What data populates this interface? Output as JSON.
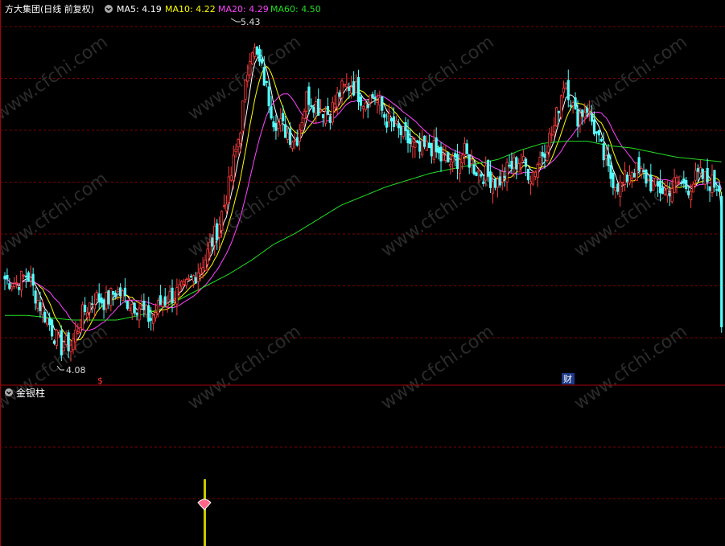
{
  "header": {
    "stock_label": "方大集团(日线 前复权)",
    "ma_labels": [
      {
        "text": "MA5: 4.19",
        "color": "#ffffff"
      },
      {
        "text": "MA10: 4.22",
        "color": "#ffff00"
      },
      {
        "text": "MA20: 4.29",
        "color": "#ff44ff"
      },
      {
        "text": "MA60: 4.50",
        "color": "#22dd22"
      }
    ]
  },
  "lower_pane": {
    "title": "金银柱"
  },
  "markers": {
    "s_marker": "$",
    "cai_marker": "财"
  },
  "watermark": "www.cfchi.com",
  "colors": {
    "up": "#ff3c3c",
    "down": "#54ffff",
    "grid": "#7a0000",
    "border": "#aa0000",
    "ma5": "#ffffff",
    "ma10": "#ffff00",
    "ma20": "#ff44ff",
    "ma60": "#22dd22",
    "signal_bar": "#c8c800",
    "signal_icon": "#ff6688"
  },
  "chart_data": {
    "type": "candlestick",
    "high_label": "5.43",
    "low_label": "4.08",
    "high_value": 5.43,
    "low_value": 4.08,
    "ylim": [
      4.02,
      5.5
    ],
    "close_path": [
      4.4,
      4.38,
      4.42,
      4.3,
      4.2,
      4.1,
      4.12,
      4.25,
      4.32,
      4.3,
      4.35,
      4.3,
      4.28,
      4.22,
      4.3,
      4.33,
      4.35,
      4.42,
      4.5,
      4.62,
      4.8,
      5.05,
      5.43,
      5.3,
      5.1,
      5.05,
      5.0,
      5.2,
      5.15,
      5.12,
      5.22,
      5.25,
      5.18,
      5.2,
      5.1,
      5.05,
      5.0,
      4.95,
      4.98,
      4.92,
      4.9,
      4.95,
      4.88,
      4.85,
      4.82,
      4.88,
      4.92,
      4.85,
      4.95,
      5.05,
      5.28,
      5.1,
      5.15,
      5.0,
      4.85,
      4.8,
      4.88,
      4.85,
      4.8,
      4.78,
      4.82,
      4.8,
      4.85,
      4.82,
      4.8
    ],
    "ma60_path": [
      4.24,
      4.24,
      4.23,
      4.22,
      4.22,
      4.22,
      4.24,
      4.27,
      4.32,
      4.37,
      4.42,
      4.48,
      4.55,
      4.6,
      4.66,
      4.72,
      4.76,
      4.8,
      4.83,
      4.86,
      4.88,
      4.9,
      4.92,
      4.96,
      4.99,
      5.0,
      5.0,
      4.98,
      4.97,
      4.95,
      4.93,
      4.92,
      4.91
    ],
    "ma60_last": 4.5,
    "signal": {
      "label": "金银柱",
      "bar_index": 254
    }
  }
}
